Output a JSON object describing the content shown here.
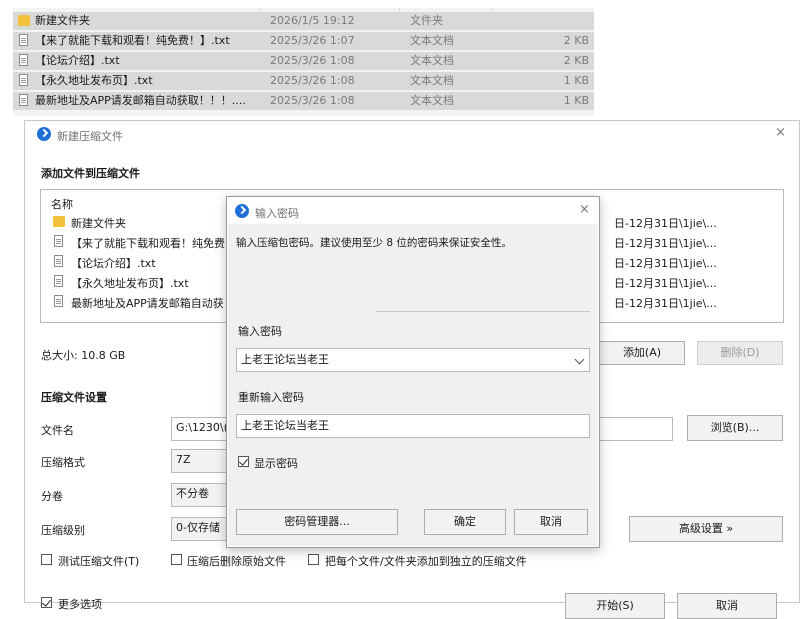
{
  "explorer": {
    "files": [
      {
        "name": "新建文件夹",
        "date": "2026/1/5 19:12",
        "type": "文件夹",
        "size": "",
        "kind": "folder"
      },
      {
        "name": "【来了就能下载和观看！纯免费！】.txt",
        "date": "2025/3/26 1:07",
        "type": "文本文档",
        "size": "2 KB",
        "kind": "doc"
      },
      {
        "name": "【论坛介绍】.txt",
        "date": "2025/3/26 1:08",
        "type": "文本文档",
        "size": "2 KB",
        "kind": "doc"
      },
      {
        "name": "【永久地址发布页】.txt",
        "date": "2025/3/26 1:08",
        "type": "文本文档",
        "size": "1 KB",
        "kind": "doc"
      },
      {
        "name": "最新地址及APP请发邮箱自动获取！！！....",
        "date": "2025/3/26 1:08",
        "type": "文本文档",
        "size": "1 KB",
        "kind": "doc"
      }
    ]
  },
  "main_dialog": {
    "title": "新建压缩文件",
    "close_icon": "×",
    "section_add": "添加文件到压缩文件",
    "list_header": "名称",
    "list_items": [
      {
        "name": "新建文件夹",
        "kind": "folder",
        "path": "日-12月31日\\1jie\\..."
      },
      {
        "name": "【来了就能下载和观看！纯免费",
        "kind": "doc",
        "path": "日-12月31日\\1jie\\..."
      },
      {
        "name": "【论坛介绍】.txt",
        "kind": "doc",
        "path": "日-12月31日\\1jie\\..."
      },
      {
        "name": "【永久地址发布页】.txt",
        "kind": "doc",
        "path": "日-12月31日\\1jie\\..."
      },
      {
        "name": "最新地址及APP请发邮箱自动获",
        "kind": "doc",
        "path": "日-12月31日\\1jie\\..."
      }
    ],
    "total_size": "总大小: 10.8 GB",
    "add_button": "添加(A)",
    "delete_button": "删除(D)",
    "section_settings": "压缩文件设置",
    "filename_label": "文件名",
    "filename_value": "G:\\1230\\(",
    "browse_button": "浏览(B)...",
    "format_label": "压缩格式",
    "format_value": "7Z",
    "split_label": "分卷",
    "split_value": "不分卷",
    "level_label": "压缩级别",
    "level_value": "0-仅存储",
    "advanced_button": "高级设置 »",
    "test_checkbox": "测试压缩文件(T)",
    "delete_after_checkbox": "压缩后删除原始文件",
    "separate_checkbox": "把每个文件/文件夹添加到独立的压缩文件",
    "more_options": "更多选项",
    "start_button": "开始(S)",
    "cancel_button": "取消"
  },
  "password_dialog": {
    "title": "输入密码",
    "close_icon": "×",
    "message": "输入压缩包密码。建议使用至少 8 位的密码来保证安全性。",
    "password_label": "输入密码",
    "password_value": "上老王论坛当老王",
    "reenter_label": "重新输入密码",
    "reenter_value": "上老王论坛当老王",
    "show_password": "显示密码",
    "show_password_checked": true,
    "manager_button": "密码管理器...",
    "ok_button": "确定",
    "cancel_button": "取消"
  }
}
